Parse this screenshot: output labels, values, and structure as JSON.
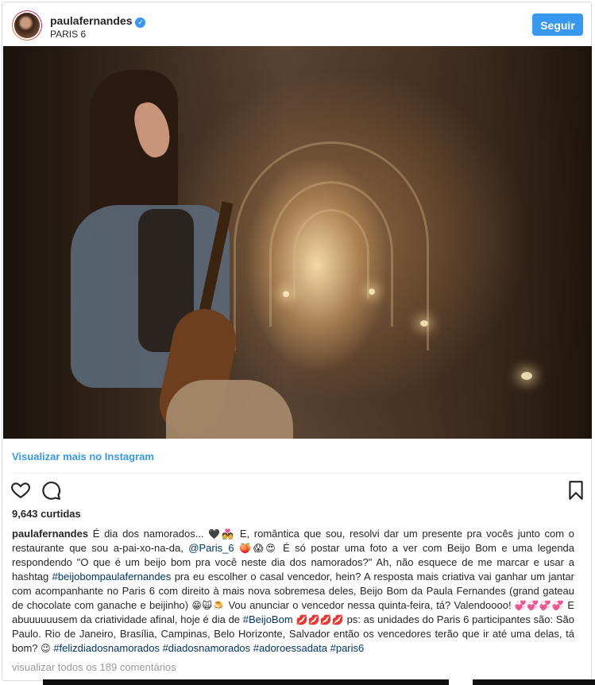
{
  "header": {
    "username": "paulafernandes",
    "verified_icon": "verified-badge-icon",
    "location": "PARIS 6",
    "follow_label": "Seguir"
  },
  "photo": {
    "alt": "photo-of-singer-with-guitar-in-tunnel"
  },
  "view_more_label": "Visualizar mais no Instagram",
  "actions": {
    "like_icon": "heart-icon",
    "comment_icon": "comment-bubble-icon",
    "save_icon": "bookmark-icon"
  },
  "likes_label": "9,643 curtidas",
  "caption": {
    "user": "paulafernandes",
    "p1": " É dia dos namorados... ",
    "e1": "🖤💑",
    "p2": " E, romântica que sou, resolvi dar um presente pra vocês junto com o restaurante que sou a-pai-xo-na-da, ",
    "mention": "@Paris_6",
    "e2": " 🍑😱😍",
    "p3": " É só postar uma foto a ver com Beijo Bom e uma legenda respondendo \"O que é um beijo bom pra você neste dia dos namorados?\" Ah, não esquece de me marcar e usar a hashtag ",
    "hashtag1": "#beijobompaulafernandes",
    "p4": " pra eu escolher o casal vencedor, hein? A resposta mais criativa vai ganhar um jantar com acompanhante no Paris 6 com direito à mais nova sobremesa deles, Beijo Bom da Paula Fernandes (grand gateau de chocolate com ganache e beijinho) ",
    "e3": "😁🙀🍮",
    "p5": " Vou anunciar o vencedor nessa quinta-feira, tá? Valendoooo! ",
    "e4": "💞💞💞💞",
    "p6": " E abuuuuuusem da criatividade afinal, hoje é dia de ",
    "hashtag2": "#BeijoBom",
    "e5": " 💋💋💋💋",
    "p7": " ps: as unidades do Paris 6 participantes são: São Paulo. Rio de Janeiro, Brasília, Campinas, Belo Horizonte, Salvador então os vencedores terão que ir até uma delas, tá bom? ",
    "e6": "😉",
    "hashtags_end": " #felizdiadosnamorados #diadosnamorados #adoroessadata #paris6"
  },
  "comments_link": "visualizar todos os 189 comentários",
  "colors": {
    "accent": "#3897f0",
    "hashtag": "#003569",
    "muted": "#999999"
  }
}
